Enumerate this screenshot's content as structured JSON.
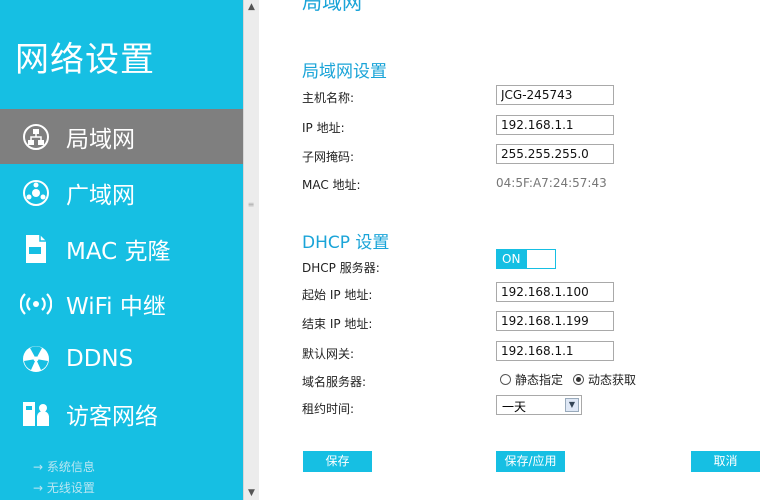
{
  "sidebar": {
    "title": "网络设置",
    "items": [
      {
        "label": "局域网"
      },
      {
        "label": "广域网"
      },
      {
        "label": "MAC 克隆"
      },
      {
        "label": "WiFi 中继"
      },
      {
        "label": "DDNS"
      },
      {
        "label": "访客网络"
      }
    ],
    "sublinks": [
      "系统信息",
      "无线设置"
    ]
  },
  "main": {
    "partial_heading": "局域网",
    "lan": {
      "title": "局域网设置",
      "hostname_label": "主机名称:",
      "hostname_value": "JCG-245743",
      "ip_label": "IP 地址:",
      "ip_value": "192.168.1.1",
      "mask_label": "子网掩码:",
      "mask_value": "255.255.255.0",
      "mac_label": "MAC 地址:",
      "mac_value": "04:5F:A7:24:57:43"
    },
    "dhcp": {
      "title": "DHCP 设置",
      "server_label": "DHCP 服务器:",
      "server_state": "ON",
      "start_label": "起始 IP 地址:",
      "start_value": "192.168.1.100",
      "end_label": "结束 IP 地址:",
      "end_value": "192.168.1.199",
      "gateway_label": "默认网关:",
      "gateway_value": "192.168.1.1",
      "dns_label": "域名服务器:",
      "dns_option_static": "静态指定",
      "dns_option_dynamic": "动态获取",
      "lease_label": "租约时间:",
      "lease_value": "一天"
    },
    "buttons": {
      "save": "保存",
      "save_apply": "保存/应用",
      "cancel": "取消"
    }
  },
  "colors": {
    "accent": "#16bfe3",
    "active_nav": "#7f7f7f",
    "section_title": "#1aa4d8"
  }
}
